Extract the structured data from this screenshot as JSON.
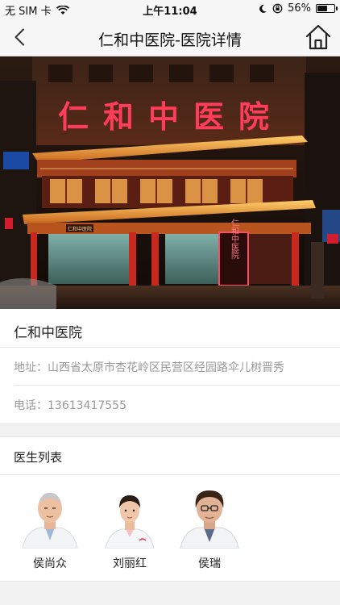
{
  "status_bar": {
    "carrier": "无 SIM 卡",
    "time": "上午11:04",
    "battery_percent": "56%",
    "battery_level": 0.56
  },
  "nav": {
    "title": "仁和中医院-医院详情",
    "back_icon": "chevron-left-icon",
    "home_icon": "home-icon"
  },
  "hero": {
    "sign_text": "仁和中医院",
    "vertical_sign": "仁和中医院",
    "shop_sign": "仁和中医院"
  },
  "hospital": {
    "name": "仁和中医院",
    "address_label": "地址：",
    "address": "山西省太原市杏花岭区民营区经园路伞儿树晋秀",
    "phone_label": "电话：",
    "phone": "13613417555"
  },
  "doctors": {
    "header": "医生列表",
    "items": [
      {
        "name": "侯尚众"
      },
      {
        "name": "刘丽红"
      },
      {
        "name": "侯瑞"
      }
    ]
  },
  "colors": {
    "accent": "#ff3d5a",
    "night_bg": "#1a0f0a",
    "gold": "#e8b447"
  }
}
